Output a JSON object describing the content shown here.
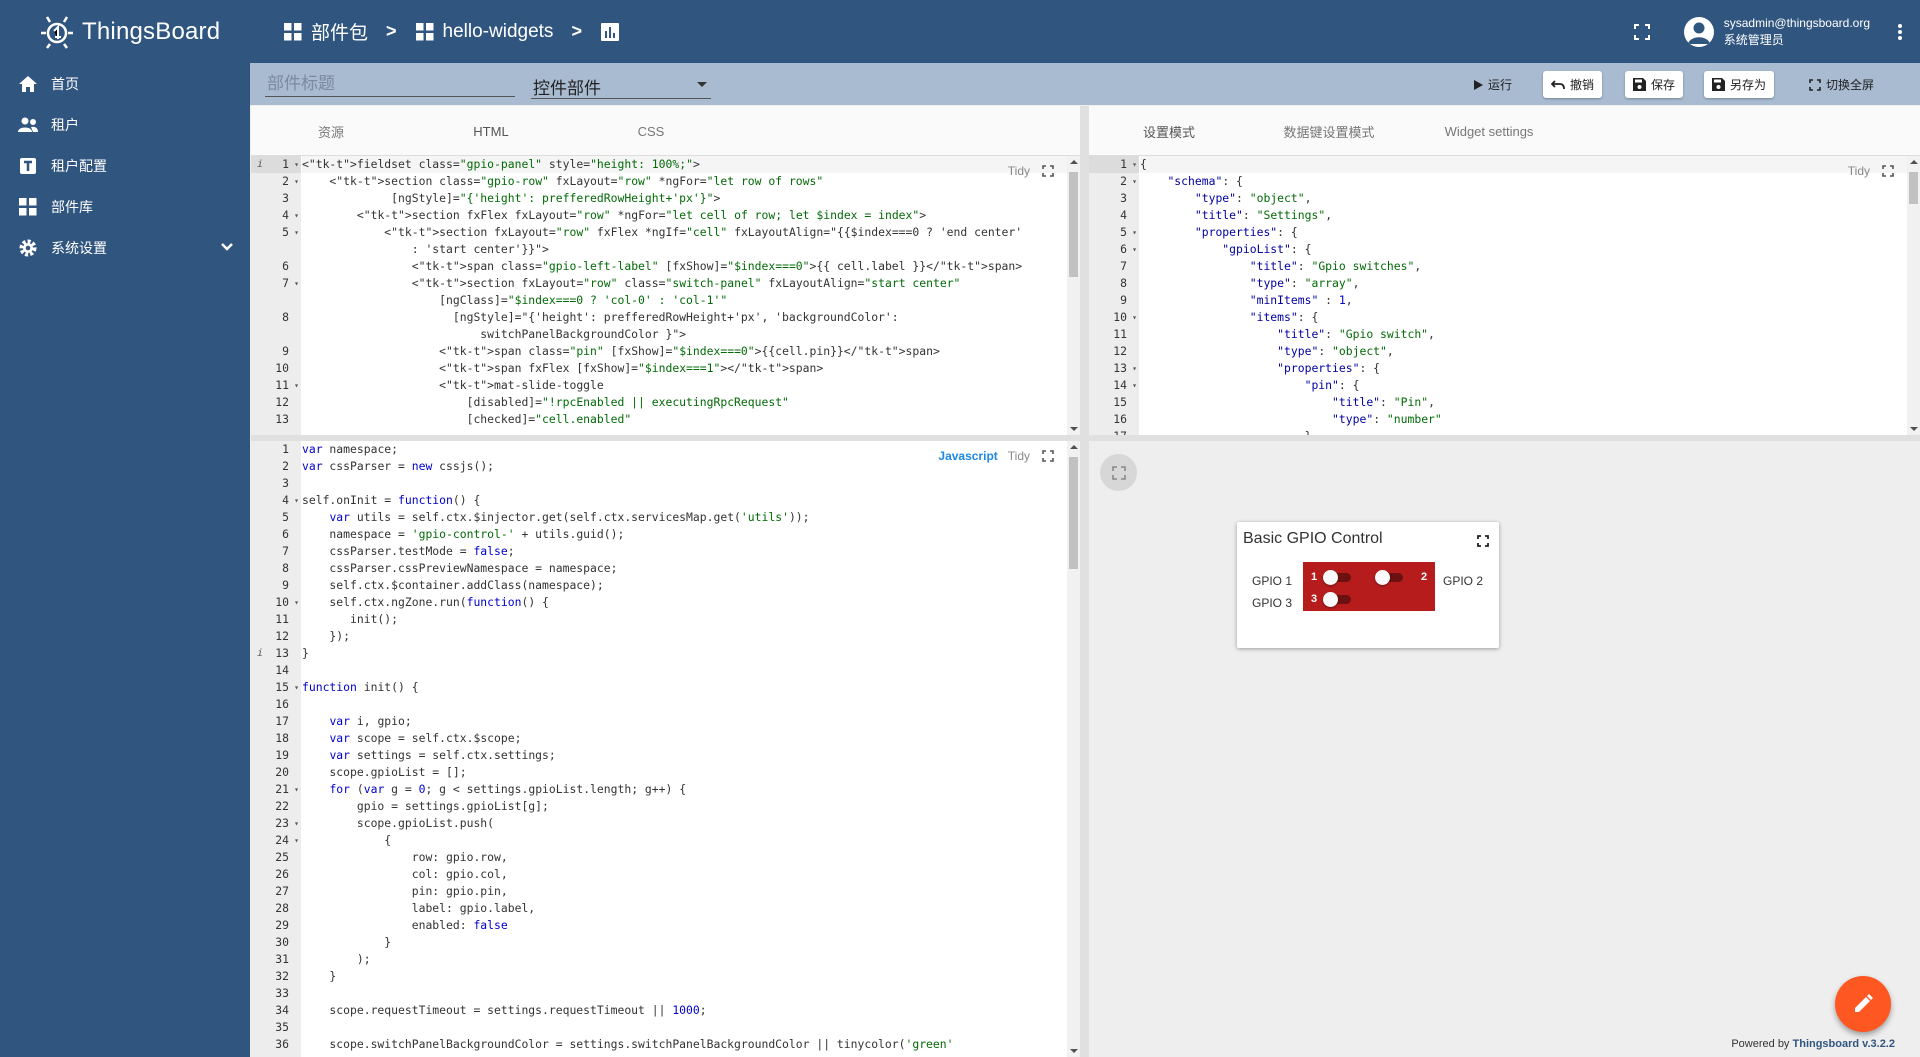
{
  "app": {
    "name": "ThingsBoard"
  },
  "sidebar": {
    "items": [
      {
        "label": "首页",
        "icon": "home-icon"
      },
      {
        "label": "租户",
        "icon": "tenants-icon"
      },
      {
        "label": "租户配置",
        "icon": "tenant-profile-icon"
      },
      {
        "label": "部件库",
        "icon": "widgets-icon"
      },
      {
        "label": "系统设置",
        "icon": "gear-icon"
      }
    ]
  },
  "breadcrumb": {
    "items": [
      "部件包",
      "hello-widgets"
    ],
    "separator": ">"
  },
  "user": {
    "email": "sysadmin@thingsboard.org",
    "role": "系统管理员"
  },
  "toolbar": {
    "title_placeholder": "部件标题",
    "widget_type": "控件部件",
    "run_label": "运行",
    "undo_label": "撤销",
    "save_label": "保存",
    "save_as_label": "另存为",
    "fullscreen_label": "切换全屏"
  },
  "left_tabs": [
    "资源",
    "HTML",
    "CSS"
  ],
  "right_tabs": [
    "设置模式",
    "数据键设置模式",
    "Widget settings"
  ],
  "editor_controls": {
    "tidy": "Tidy",
    "mode": "Javascript"
  },
  "html_editor": {
    "lines": [
      {
        "n": "1",
        "fold": true,
        "info": true,
        "text": "<fieldset class=\"gpio-panel\" style=\"height: 100%;\">"
      },
      {
        "n": "2",
        "fold": true,
        "text": "    <section class=\"gpio-row\" fxLayout=\"row\" *ngFor=\"let row of rows\""
      },
      {
        "n": "3",
        "text": "             [ngStyle]=\"{'height': prefferedRowHeight+'px'}\">"
      },
      {
        "n": "4",
        "fold": true,
        "text": "        <section fxFlex fxLayout=\"row\" *ngFor=\"let cell of row; let $index = index\">"
      },
      {
        "n": "5",
        "fold": true,
        "text": "            <section fxLayout=\"row\" fxFlex *ngIf=\"cell\" fxLayoutAlign=\"{{$index===0 ? 'end center'"
      },
      {
        "n": "",
        "text": "                : 'start center'}}\">"
      },
      {
        "n": "6",
        "text": "                <span class=\"gpio-left-label\" [fxShow]=\"$index===0\">{{ cell.label }}</span>"
      },
      {
        "n": "7",
        "fold": true,
        "text": "                <section fxLayout=\"row\" class=\"switch-panel\" fxLayoutAlign=\"start center\""
      },
      {
        "n": "",
        "text": "                    [ngClass]=\"$index===0 ? 'col-0' : 'col-1'\""
      },
      {
        "n": "8",
        "text": "                      [ngStyle]=\"{'height': prefferedRowHeight+'px', 'backgroundColor':"
      },
      {
        "n": "",
        "text": "                          switchPanelBackgroundColor }\">"
      },
      {
        "n": "9",
        "text": "                    <span class=\"pin\" [fxShow]=\"$index===0\">{{cell.pin}}</span>"
      },
      {
        "n": "10",
        "text": "                    <span fxFlex [fxShow]=\"$index===1\"></span>"
      },
      {
        "n": "11",
        "fold": true,
        "text": "                    <mat-slide-toggle"
      },
      {
        "n": "12",
        "text": "                        [disabled]=\"!rpcEnabled || executingRpcRequest\""
      },
      {
        "n": "13",
        "text": "                        [checked]=\"cell.enabled\""
      }
    ]
  },
  "settings_editor": {
    "lines": [
      {
        "n": "1",
        "fold": true,
        "text": "{"
      },
      {
        "n": "2",
        "fold": true,
        "text": "    \"schema\": {"
      },
      {
        "n": "3",
        "text": "        \"type\": \"object\","
      },
      {
        "n": "4",
        "text": "        \"title\": \"Settings\","
      },
      {
        "n": "5",
        "fold": true,
        "text": "        \"properties\": {"
      },
      {
        "n": "6",
        "fold": true,
        "text": "            \"gpioList\": {"
      },
      {
        "n": "7",
        "text": "                \"title\": \"Gpio switches\","
      },
      {
        "n": "8",
        "text": "                \"type\": \"array\","
      },
      {
        "n": "9",
        "text": "                \"minItems\" : 1,"
      },
      {
        "n": "10",
        "fold": true,
        "text": "                \"items\": {"
      },
      {
        "n": "11",
        "text": "                    \"title\": \"Gpio switch\","
      },
      {
        "n": "12",
        "text": "                    \"type\": \"object\","
      },
      {
        "n": "13",
        "fold": true,
        "text": "                    \"properties\": {"
      },
      {
        "n": "14",
        "fold": true,
        "text": "                        \"pin\": {"
      },
      {
        "n": "15",
        "text": "                            \"title\": \"Pin\","
      },
      {
        "n": "16",
        "text": "                            \"type\": \"number\""
      },
      {
        "n": "17",
        "text": "                        },"
      }
    ]
  },
  "js_editor": {
    "lines": [
      {
        "n": "1",
        "text": "var namespace;"
      },
      {
        "n": "2",
        "text": "var cssParser = new cssjs();"
      },
      {
        "n": "3",
        "text": ""
      },
      {
        "n": "4",
        "fold": true,
        "text": "self.onInit = function() {"
      },
      {
        "n": "5",
        "text": "    var utils = self.ctx.$injector.get(self.ctx.servicesMap.get('utils'));"
      },
      {
        "n": "6",
        "text": "    namespace = 'gpio-control-' + utils.guid();"
      },
      {
        "n": "7",
        "text": "    cssParser.testMode = false;"
      },
      {
        "n": "8",
        "text": "    cssParser.cssPreviewNamespace = namespace;"
      },
      {
        "n": "9",
        "text": "    self.ctx.$container.addClass(namespace);"
      },
      {
        "n": "10",
        "fold": true,
        "text": "    self.ctx.ngZone.run(function() {"
      },
      {
        "n": "11",
        "text": "       init();"
      },
      {
        "n": "12",
        "text": "    });"
      },
      {
        "n": "13",
        "info": true,
        "text": "}"
      },
      {
        "n": "14",
        "text": ""
      },
      {
        "n": "15",
        "fold": true,
        "text": "function init() {"
      },
      {
        "n": "16",
        "text": ""
      },
      {
        "n": "17",
        "text": "    var i, gpio;"
      },
      {
        "n": "18",
        "text": "    var scope = self.ctx.$scope;"
      },
      {
        "n": "19",
        "text": "    var settings = self.ctx.settings;"
      },
      {
        "n": "20",
        "text": "    scope.gpioList = [];"
      },
      {
        "n": "21",
        "fold": true,
        "text": "    for (var g = 0; g < settings.gpioList.length; g++) {"
      },
      {
        "n": "22",
        "text": "        gpio = settings.gpioList[g];"
      },
      {
        "n": "23",
        "fold": true,
        "text": "        scope.gpioList.push("
      },
      {
        "n": "24",
        "fold": true,
        "text": "            {"
      },
      {
        "n": "25",
        "text": "                row: gpio.row,"
      },
      {
        "n": "26",
        "text": "                col: gpio.col,"
      },
      {
        "n": "27",
        "text": "                pin: gpio.pin,"
      },
      {
        "n": "28",
        "text": "                label: gpio.label,"
      },
      {
        "n": "29",
        "text": "                enabled: false"
      },
      {
        "n": "30",
        "text": "            }"
      },
      {
        "n": "31",
        "text": "        );"
      },
      {
        "n": "32",
        "text": "    }"
      },
      {
        "n": "33",
        "text": ""
      },
      {
        "n": "34",
        "text": "    scope.requestTimeout = settings.requestTimeout || 1000;"
      },
      {
        "n": "35",
        "text": ""
      },
      {
        "n": "36",
        "text": "    scope.switchPanelBackgroundColor = settings.switchPanelBackgroundColor || tinycolor('green'"
      }
    ]
  },
  "widget": {
    "title": "Basic GPIO Control",
    "labels": [
      "GPIO 1",
      "GPIO 2",
      "GPIO 3"
    ],
    "pins": [
      "1",
      "2",
      "3"
    ],
    "panel_color": "#b71c1c"
  },
  "footer": {
    "powered_prefix": "Powered by",
    "powered_link": "Thingsboard v.3.2.2"
  },
  "colors": {
    "primary": "#305680",
    "toolbar": "#a8bbd0",
    "fab": "#ff5722"
  }
}
